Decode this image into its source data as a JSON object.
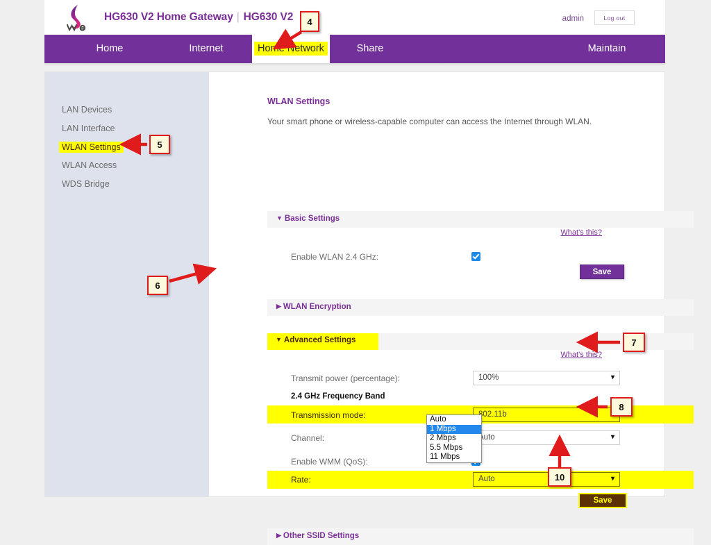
{
  "header": {
    "logo_name": "we-logo",
    "brand_title": "HG630 V2 Home Gateway",
    "brand_divider": "|",
    "brand_model": "HG630 V2",
    "admin_label": "admin",
    "logout_label": "Log out"
  },
  "nav": {
    "items": [
      {
        "label": "Home",
        "active": false
      },
      {
        "label": "Internet",
        "active": false
      },
      {
        "label": "Home Network",
        "active": true
      },
      {
        "label": "Share",
        "active": false
      },
      {
        "label": "Maintain",
        "active": false
      }
    ]
  },
  "sidebar": {
    "items": [
      {
        "label": "LAN Devices"
      },
      {
        "label": "LAN Interface"
      },
      {
        "label": "WLAN Settings"
      },
      {
        "label": "WLAN Access"
      },
      {
        "label": "WDS Bridge"
      }
    ]
  },
  "main": {
    "page_title": "WLAN Settings",
    "page_desc": "Your smart phone or wireless-capable computer can access the Internet through WLAN.",
    "whats_this": "What's this?",
    "sections": {
      "basic": {
        "label": "Basic Settings",
        "triangle": "▼",
        "expanded": true
      },
      "encryption": {
        "label": "WLAN Encryption",
        "triangle": "▶",
        "expanded": false
      },
      "advanced": {
        "label": "Advanced Settings",
        "triangle": "▼",
        "expanded": true
      },
      "other_ssid": {
        "label": "Other SSID Settings",
        "triangle": "▶",
        "expanded": false
      }
    },
    "basic": {
      "enable_wlan_label": "Enable WLAN 2.4 GHz:",
      "enable_wlan_checked": true,
      "save_label": "Save"
    },
    "advanced": {
      "transmit_power_label": "Transmit power (percentage):",
      "transmit_power_value": "100%",
      "band_heading": "2.4 GHz Frequency Band",
      "transmission_mode_label": "Transmission mode:",
      "transmission_mode_value": "802.11b",
      "channel_label": "Channel:",
      "channel_value": "Auto",
      "wmm_label": "Enable WMM (QoS):",
      "wmm_checked": true,
      "rate_label": "Rate:",
      "rate_value": "Auto",
      "rate_options": [
        "Auto",
        "1 Mbps",
        "2 Mbps",
        "5.5 Mbps",
        "11 Mbps"
      ],
      "rate_selected_index": 1,
      "save_label": "Save"
    }
  },
  "callouts": [
    {
      "id": "4",
      "text": "4"
    },
    {
      "id": "5",
      "text": "5"
    },
    {
      "id": "6",
      "text": "6"
    },
    {
      "id": "7",
      "text": "7"
    },
    {
      "id": "8",
      "text": "8"
    },
    {
      "id": "10",
      "text": "10"
    }
  ],
  "colors": {
    "brand_purple": "#72309a",
    "highlight_yellow": "#ffff00",
    "callout_red": "#e01b1b",
    "callout_fill": "#fdf9dc",
    "sidebar_bg": "#dde2ed",
    "selected_blue": "#2288ee",
    "save_brown": "#5c3205"
  }
}
